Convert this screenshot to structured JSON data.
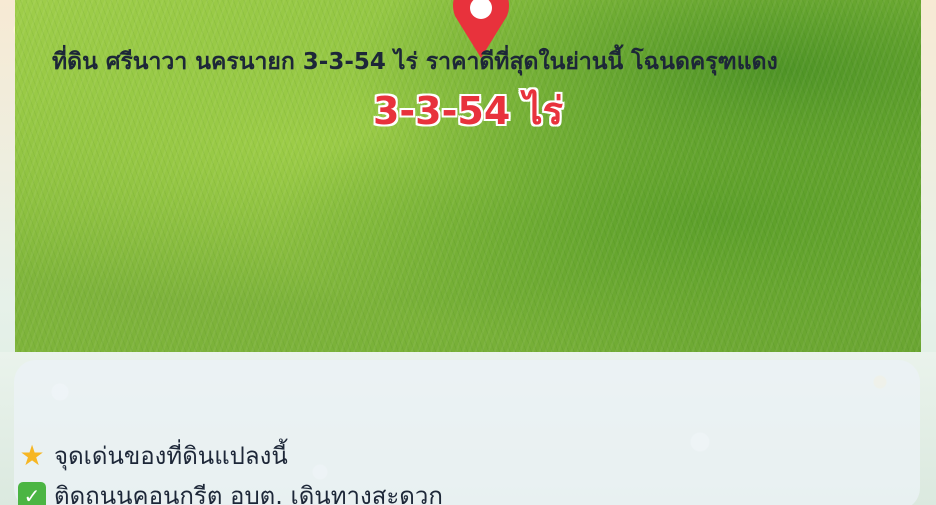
{
  "photo": {
    "area_label": "3-3-54 ไร่"
  },
  "listing": {
    "headline": "ที่ดิน ศรีนาวา นครนายก 3-3-54 ไร่  ราคาดีที่สุดในย่านนี้ โฉนดครุฑแดง",
    "highlights_heading": "จุดเด่นของที่ดินแปลงนี้",
    "highlights_icon": "star-icon",
    "features": [
      {
        "icon": "check-icon",
        "text": "ติดถนนคอนกรีต อบต. เดินทางสะดวก"
      }
    ]
  },
  "colors": {
    "pin": "#e8323c",
    "label": "#e8323c",
    "star": "#f6b623",
    "check": "#4bb543"
  }
}
